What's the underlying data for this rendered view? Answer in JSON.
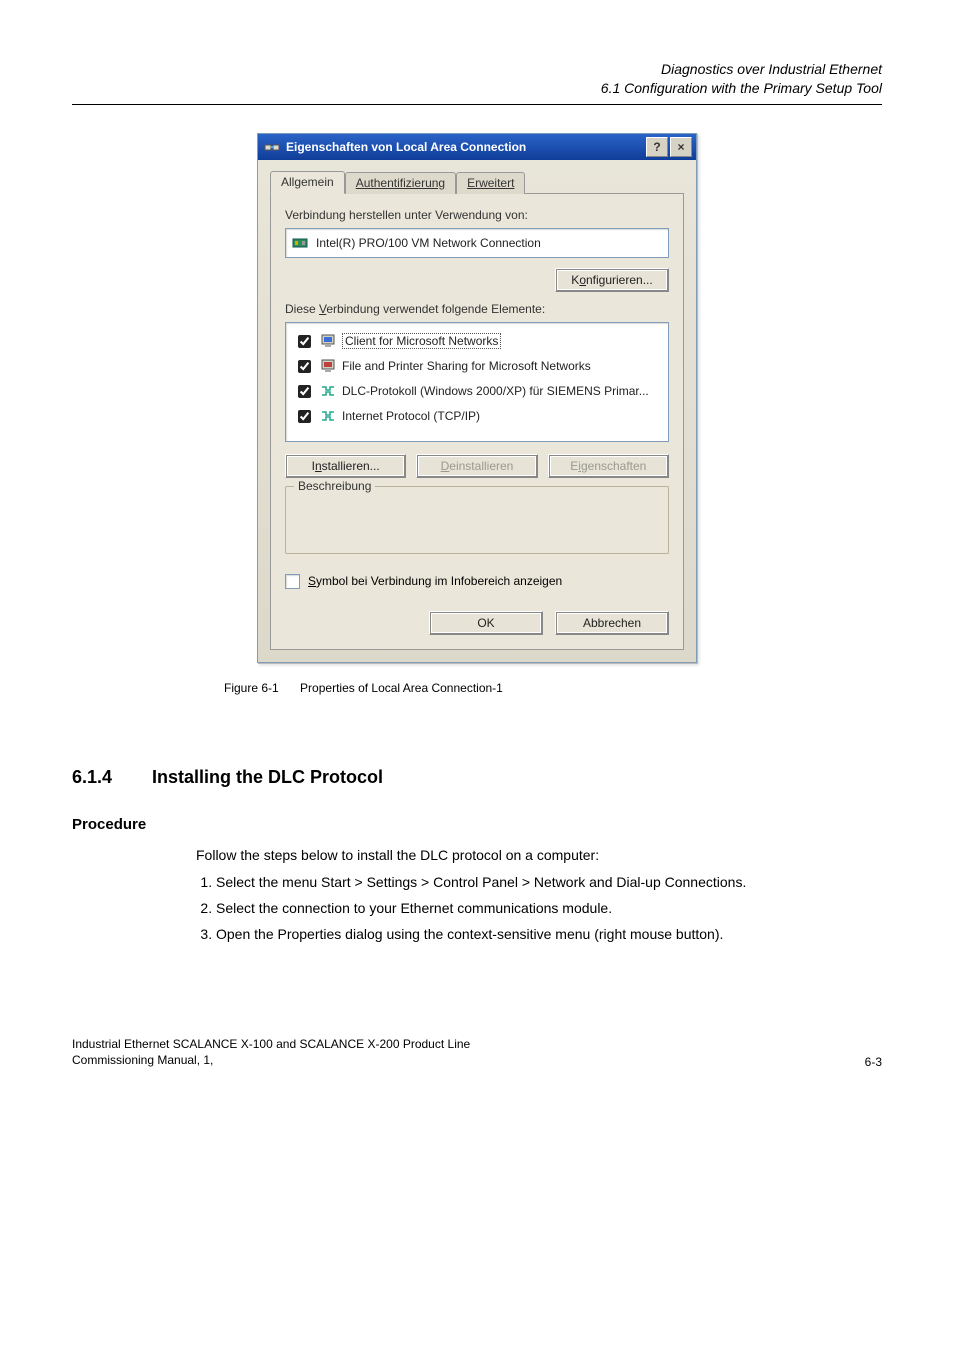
{
  "header": {
    "line1": "Diagnostics over Industrial Ethernet",
    "line2": "6.1 Configuration with the Primary Setup Tool"
  },
  "dialog": {
    "title": "Eigenschaften von Local Area Connection",
    "help_glyph": "?",
    "close_glyph": "×",
    "tabs": {
      "general": "Allgemein",
      "auth": "Authentifizierung",
      "advanced": "Erweitert"
    },
    "label_connect_using": "Verbindung herstellen unter Verwendung von:",
    "adapter_name": "Intel(R) PRO/100 VM Network Connection",
    "btn_configure": "Konfigurieren...",
    "label_uses_elements": "Diese Verbindung verwendet folgende Elemente:",
    "items": [
      {
        "label": "Client for Microsoft Networks",
        "checked": true,
        "selected": true,
        "icon": "client-icon"
      },
      {
        "label": "File and Printer Sharing for Microsoft Networks",
        "checked": true,
        "selected": false,
        "icon": "service-icon"
      },
      {
        "label": "DLC-Protokoll (Windows 2000/XP) für SIEMENS Primar...",
        "checked": true,
        "selected": false,
        "icon": "protocol-icon"
      },
      {
        "label": "Internet Protocol (TCP/IP)",
        "checked": true,
        "selected": false,
        "icon": "protocol-icon"
      }
    ],
    "btn_install": "Installieren...",
    "btn_uninstall": "Deinstallieren",
    "btn_properties": "Eigenschaften",
    "group_description": "Beschreibung",
    "chk_show_icon": "Symbol bei Verbindung im Infobereich anzeigen",
    "btn_ok": "OK",
    "btn_cancel": "Abbrechen"
  },
  "figure_caption": {
    "num": "Figure 6-1",
    "text": "Properties of Local Area Connection-1"
  },
  "section": {
    "num": "6.1.4",
    "title": "Installing the DLC Protocol"
  },
  "procedure": {
    "heading": "Procedure",
    "intro": "Follow the steps below to install the DLC protocol on a computer:",
    "steps": [
      "Select the menu Start > Settings > Control Panel > Network and Dial-up Connections.",
      "Select the connection to your Ethernet communications module.",
      "Open the Properties dialog using the context-sensitive menu (right mouse button)."
    ]
  },
  "footer": {
    "line1": "Industrial Ethernet SCALANCE X-100 and SCALANCE X-200 Product Line",
    "line2": "Commissioning Manual, 1,",
    "page": "6-3"
  }
}
